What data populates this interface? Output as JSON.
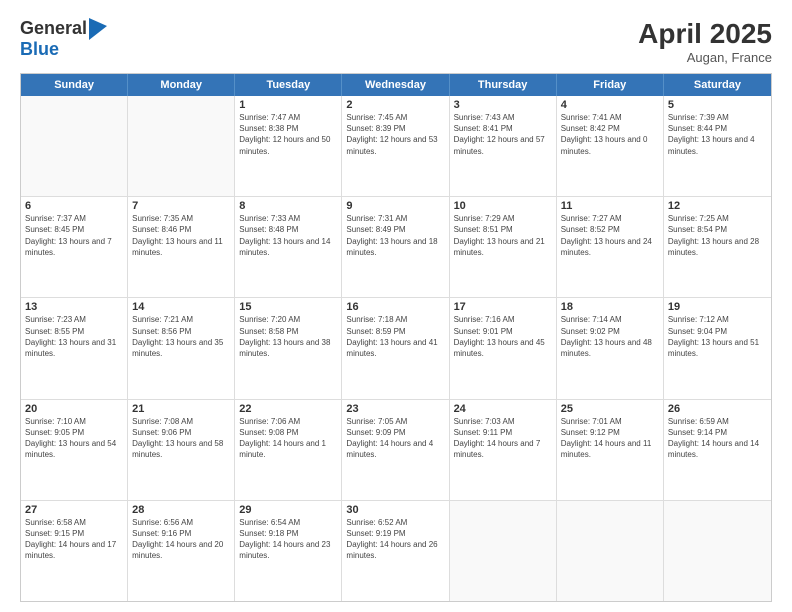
{
  "logo": {
    "line1": "General",
    "line2": "Blue"
  },
  "title": "April 2025",
  "subtitle": "Augan, France",
  "header_days": [
    "Sunday",
    "Monday",
    "Tuesday",
    "Wednesday",
    "Thursday",
    "Friday",
    "Saturday"
  ],
  "rows": [
    [
      {
        "day": "",
        "info": ""
      },
      {
        "day": "",
        "info": ""
      },
      {
        "day": "1",
        "info": "Sunrise: 7:47 AM\nSunset: 8:38 PM\nDaylight: 12 hours and 50 minutes."
      },
      {
        "day": "2",
        "info": "Sunrise: 7:45 AM\nSunset: 8:39 PM\nDaylight: 12 hours and 53 minutes."
      },
      {
        "day": "3",
        "info": "Sunrise: 7:43 AM\nSunset: 8:41 PM\nDaylight: 12 hours and 57 minutes."
      },
      {
        "day": "4",
        "info": "Sunrise: 7:41 AM\nSunset: 8:42 PM\nDaylight: 13 hours and 0 minutes."
      },
      {
        "day": "5",
        "info": "Sunrise: 7:39 AM\nSunset: 8:44 PM\nDaylight: 13 hours and 4 minutes."
      }
    ],
    [
      {
        "day": "6",
        "info": "Sunrise: 7:37 AM\nSunset: 8:45 PM\nDaylight: 13 hours and 7 minutes."
      },
      {
        "day": "7",
        "info": "Sunrise: 7:35 AM\nSunset: 8:46 PM\nDaylight: 13 hours and 11 minutes."
      },
      {
        "day": "8",
        "info": "Sunrise: 7:33 AM\nSunset: 8:48 PM\nDaylight: 13 hours and 14 minutes."
      },
      {
        "day": "9",
        "info": "Sunrise: 7:31 AM\nSunset: 8:49 PM\nDaylight: 13 hours and 18 minutes."
      },
      {
        "day": "10",
        "info": "Sunrise: 7:29 AM\nSunset: 8:51 PM\nDaylight: 13 hours and 21 minutes."
      },
      {
        "day": "11",
        "info": "Sunrise: 7:27 AM\nSunset: 8:52 PM\nDaylight: 13 hours and 24 minutes."
      },
      {
        "day": "12",
        "info": "Sunrise: 7:25 AM\nSunset: 8:54 PM\nDaylight: 13 hours and 28 minutes."
      }
    ],
    [
      {
        "day": "13",
        "info": "Sunrise: 7:23 AM\nSunset: 8:55 PM\nDaylight: 13 hours and 31 minutes."
      },
      {
        "day": "14",
        "info": "Sunrise: 7:21 AM\nSunset: 8:56 PM\nDaylight: 13 hours and 35 minutes."
      },
      {
        "day": "15",
        "info": "Sunrise: 7:20 AM\nSunset: 8:58 PM\nDaylight: 13 hours and 38 minutes."
      },
      {
        "day": "16",
        "info": "Sunrise: 7:18 AM\nSunset: 8:59 PM\nDaylight: 13 hours and 41 minutes."
      },
      {
        "day": "17",
        "info": "Sunrise: 7:16 AM\nSunset: 9:01 PM\nDaylight: 13 hours and 45 minutes."
      },
      {
        "day": "18",
        "info": "Sunrise: 7:14 AM\nSunset: 9:02 PM\nDaylight: 13 hours and 48 minutes."
      },
      {
        "day": "19",
        "info": "Sunrise: 7:12 AM\nSunset: 9:04 PM\nDaylight: 13 hours and 51 minutes."
      }
    ],
    [
      {
        "day": "20",
        "info": "Sunrise: 7:10 AM\nSunset: 9:05 PM\nDaylight: 13 hours and 54 minutes."
      },
      {
        "day": "21",
        "info": "Sunrise: 7:08 AM\nSunset: 9:06 PM\nDaylight: 13 hours and 58 minutes."
      },
      {
        "day": "22",
        "info": "Sunrise: 7:06 AM\nSunset: 9:08 PM\nDaylight: 14 hours and 1 minute."
      },
      {
        "day": "23",
        "info": "Sunrise: 7:05 AM\nSunset: 9:09 PM\nDaylight: 14 hours and 4 minutes."
      },
      {
        "day": "24",
        "info": "Sunrise: 7:03 AM\nSunset: 9:11 PM\nDaylight: 14 hours and 7 minutes."
      },
      {
        "day": "25",
        "info": "Sunrise: 7:01 AM\nSunset: 9:12 PM\nDaylight: 14 hours and 11 minutes."
      },
      {
        "day": "26",
        "info": "Sunrise: 6:59 AM\nSunset: 9:14 PM\nDaylight: 14 hours and 14 minutes."
      }
    ],
    [
      {
        "day": "27",
        "info": "Sunrise: 6:58 AM\nSunset: 9:15 PM\nDaylight: 14 hours and 17 minutes."
      },
      {
        "day": "28",
        "info": "Sunrise: 6:56 AM\nSunset: 9:16 PM\nDaylight: 14 hours and 20 minutes."
      },
      {
        "day": "29",
        "info": "Sunrise: 6:54 AM\nSunset: 9:18 PM\nDaylight: 14 hours and 23 minutes."
      },
      {
        "day": "30",
        "info": "Sunrise: 6:52 AM\nSunset: 9:19 PM\nDaylight: 14 hours and 26 minutes."
      },
      {
        "day": "",
        "info": ""
      },
      {
        "day": "",
        "info": ""
      },
      {
        "day": "",
        "info": ""
      }
    ]
  ]
}
